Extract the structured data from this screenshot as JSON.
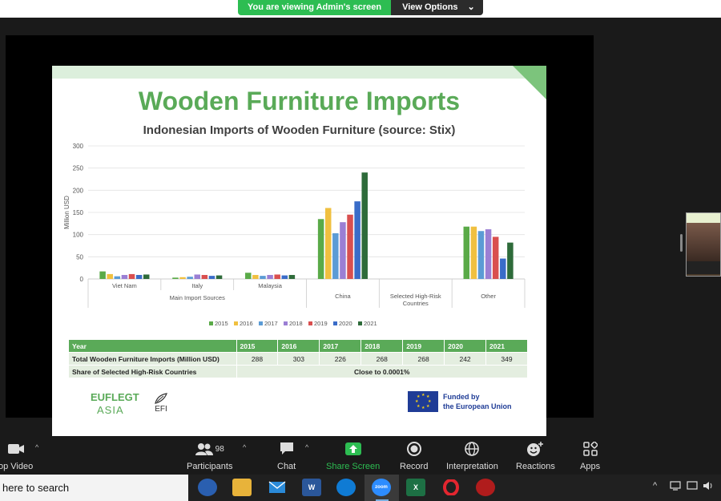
{
  "banner": {
    "viewing": "You are viewing Admin's screen",
    "options": "View Options"
  },
  "slide": {
    "title": "Wooden Furniture Imports",
    "chart_title": "Indonesian Imports of Wooden Furniture (source: Stix)"
  },
  "chart_data": {
    "type": "bar",
    "title": "Indonesian Imports of Wooden Furniture (source: Stix)",
    "ylabel": "Million USD",
    "xlabel": "",
    "ylim": [
      0,
      300
    ],
    "yticks": [
      0,
      50,
      100,
      150,
      200,
      250,
      300
    ],
    "categories": [
      "Viet Nam",
      "Italy",
      "Malaysia",
      "China",
      "Selected High-Risk Countries",
      "Other"
    ],
    "groups": [
      {
        "label": "Main Import Sources",
        "categories": [
          "Viet Nam",
          "Italy",
          "Malaysia"
        ]
      }
    ],
    "series": [
      {
        "name": "2015",
        "color": "#5aaa48",
        "values": [
          17,
          3,
          14,
          135,
          0,
          118
        ]
      },
      {
        "name": "2016",
        "color": "#f0c040",
        "values": [
          11,
          4,
          9,
          160,
          0,
          118
        ]
      },
      {
        "name": "2017",
        "color": "#5b9bd5",
        "values": [
          6,
          5,
          7,
          103,
          0,
          108
        ]
      },
      {
        "name": "2018",
        "color": "#9b7fd4",
        "values": [
          9,
          10,
          9,
          128,
          0,
          112
        ]
      },
      {
        "name": "2019",
        "color": "#d94f4f",
        "values": [
          11,
          9,
          10,
          145,
          0,
          95
        ]
      },
      {
        "name": "2020",
        "color": "#3a6cc8",
        "values": [
          9,
          7,
          8,
          175,
          0,
          46
        ]
      },
      {
        "name": "2021",
        "color": "#2e6b3a",
        "values": [
          10,
          8,
          9,
          240,
          0,
          82
        ]
      }
    ],
    "legend": "bottom",
    "grid": true
  },
  "table": {
    "header_label": "Year",
    "years": [
      "2015",
      "2016",
      "2017",
      "2018",
      "2019",
      "2020",
      "2021"
    ],
    "row1_label": "Total Wooden Furniture Imports (Million USD)",
    "row1_values": [
      "288",
      "303",
      "226",
      "268",
      "268",
      "242",
      "349"
    ],
    "row2_label": "Share of Selected High-Risk Countries",
    "row2_value": "Close to 0.0001%"
  },
  "logos": {
    "euflegt": "EUFLEGT",
    "asia": "ASIA",
    "efi": "EFI",
    "funded_line1": "Funded by",
    "funded_line2": "the European Union"
  },
  "toolbar": {
    "video": "op Video",
    "participants": "Participants",
    "participant_count": "98",
    "chat": "Chat",
    "share": "Share Screen",
    "record": "Record",
    "interpretation": "Interpretation",
    "reactions": "Reactions",
    "apps": "Apps"
  },
  "taskbar": {
    "search": "here to search",
    "zoom_label": "zoom"
  }
}
